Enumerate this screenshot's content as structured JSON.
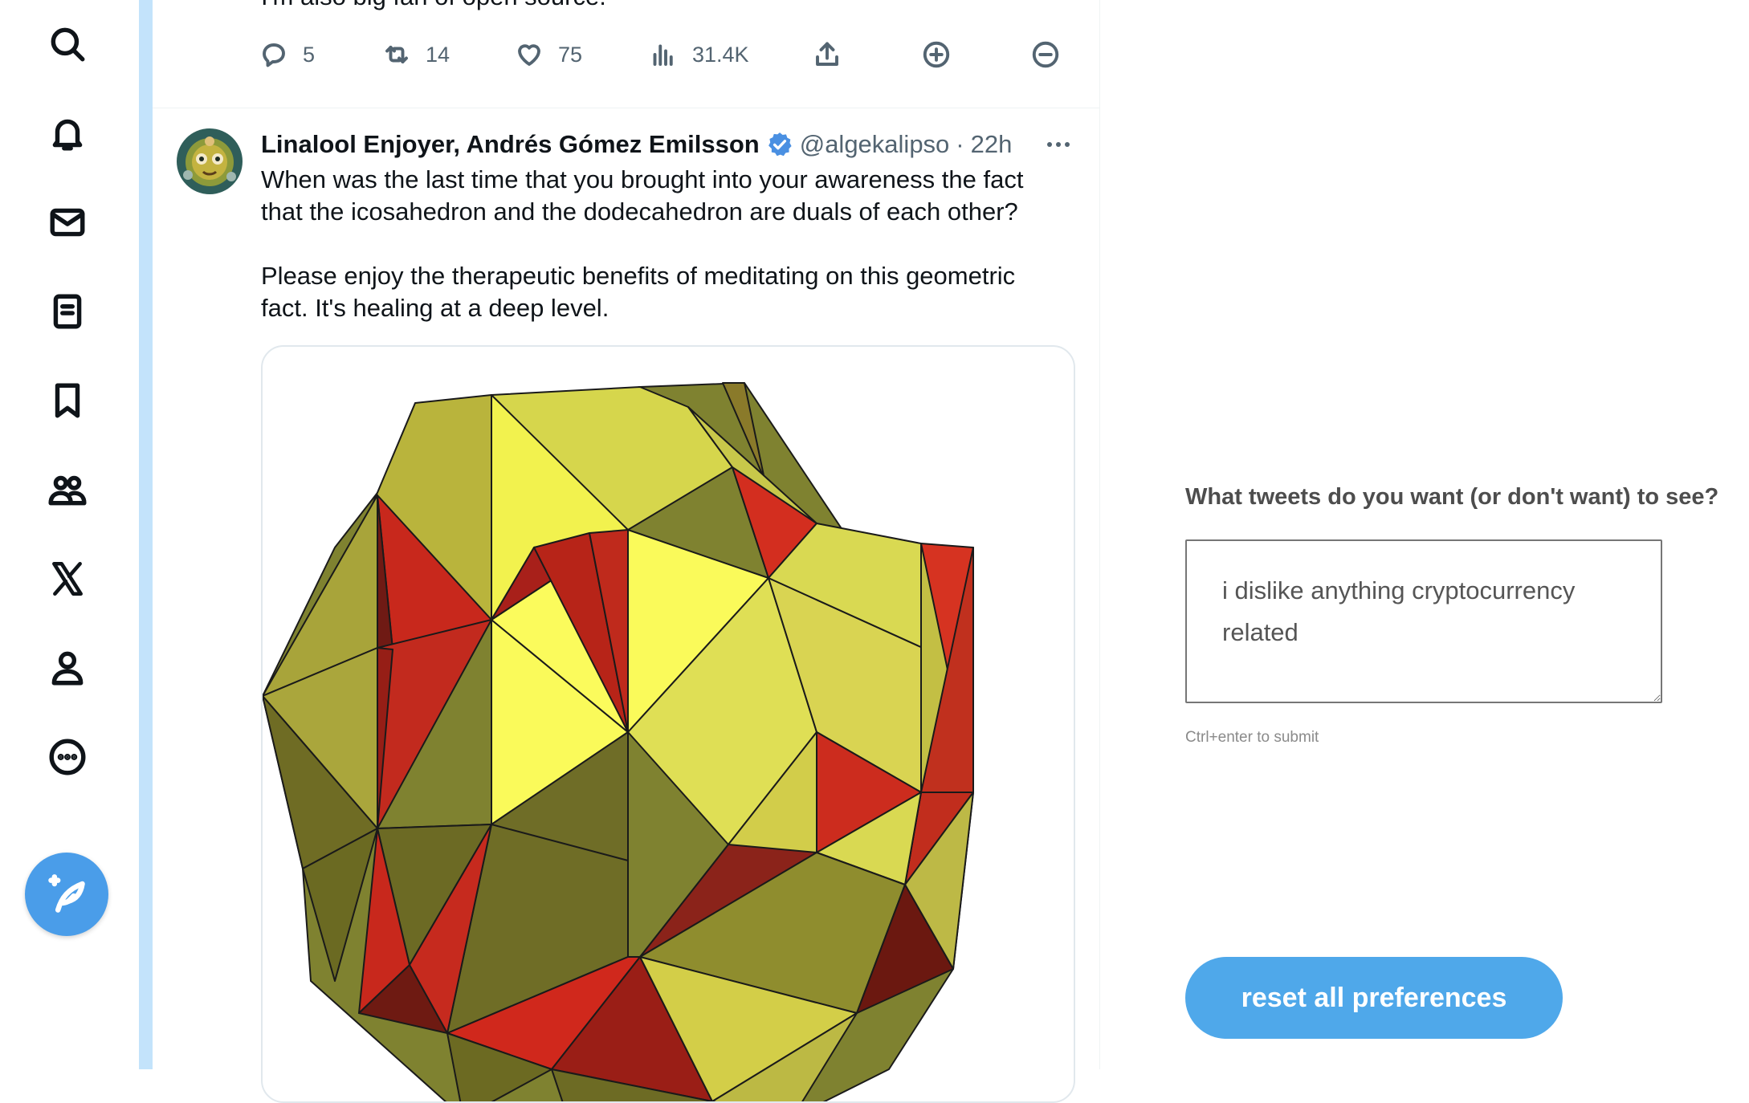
{
  "nav": {
    "items": [
      {
        "icon": "search-icon"
      },
      {
        "icon": "bell-icon"
      },
      {
        "icon": "mail-icon"
      },
      {
        "icon": "lists-icon"
      },
      {
        "icon": "bookmark-icon"
      },
      {
        "icon": "communities-icon"
      },
      {
        "icon": "x-logo-icon"
      },
      {
        "icon": "profile-icon"
      },
      {
        "icon": "more-circle-icon"
      }
    ],
    "compose_icon": "compose-feather-icon",
    "compose_color": "#4a9de9"
  },
  "prev_tweet": {
    "text_tail": "I'm also big fan of open source.",
    "stats": {
      "replies": "5",
      "retweets": "14",
      "likes": "75",
      "views": "31.4K"
    }
  },
  "tweet": {
    "author": "Linalool Enjoyer, Andrés Gómez Emilsson",
    "handle": "@algekalipso",
    "separator": "·",
    "time": "22h",
    "paragraphs": [
      "When was the last time that you brought into your awareness the fact that the icosahedron and the dodecahedron are duals of each other?",
      "Please enjoy the therapeutic benefits of meditating on this geometric fact. It's healing at a deep level."
    ],
    "verified_color": "#4a90e2"
  },
  "preferences": {
    "title": "What tweets do you want (or don't want) to see?",
    "input_value": "i dislike anything cryptocurrency related",
    "hint": "Ctrl+enter to submit",
    "reset_label": "reset all preferences",
    "button_color": "#4fa8ea"
  },
  "colors": {
    "thread_bar": "#c3e3fb",
    "text_secondary": "#536471"
  }
}
